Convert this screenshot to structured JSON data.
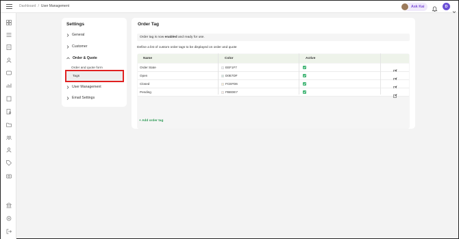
{
  "breadcrumb": {
    "home": "Dashboard",
    "separator": "/",
    "current": "User Management"
  },
  "header": {
    "ask_label": "Ask Kai",
    "user_initial": "D"
  },
  "rail_icons": [
    "dashboard-icon",
    "list-icon",
    "document-icon",
    "person-icon",
    "chat-icon",
    "chart-icon",
    "clipboard-icon",
    "doc-search-icon",
    "folder-icon",
    "team-icon",
    "user-icon",
    "tag-icon",
    "camera-icon",
    "bank-icon",
    "settings-icon",
    "logout-icon"
  ],
  "settings": {
    "title": "Settings",
    "items": [
      {
        "label": "General",
        "expanded": false
      },
      {
        "label": "Customer",
        "expanded": false
      },
      {
        "label": "Order & Quote",
        "expanded": true
      },
      {
        "label": "User Management",
        "expanded": false
      },
      {
        "label": "Email Settings",
        "expanded": false
      }
    ],
    "sub_items": [
      "Order and quote form",
      "Tags"
    ],
    "selected": "Tags"
  },
  "order_tag": {
    "title": "Order Tag",
    "notice_pre": "Order tag is now ",
    "notice_bold": "enabled",
    "notice_post": " and ready for use.",
    "description": "Define a list of custom order tags to be displayed on order and quote",
    "columns": {
      "name": "Name",
      "color": "Color",
      "active": "Active"
    },
    "rows": [
      {
        "name": "Order State",
        "color": "EEF1F7",
        "active": true
      },
      {
        "name": "Open",
        "color": "D0E7DF",
        "active": true
      },
      {
        "name": "Closed",
        "color": "FCEFD6",
        "active": true
      },
      {
        "name": "Pending",
        "color": "FBEDE7",
        "active": true
      }
    ],
    "add_label": "+ Add order tag"
  },
  "colors": {
    "accent": "#2e9b56",
    "selection": "#e02020",
    "avatar": "#6a4fd6",
    "ask": "#7a4cd8"
  }
}
